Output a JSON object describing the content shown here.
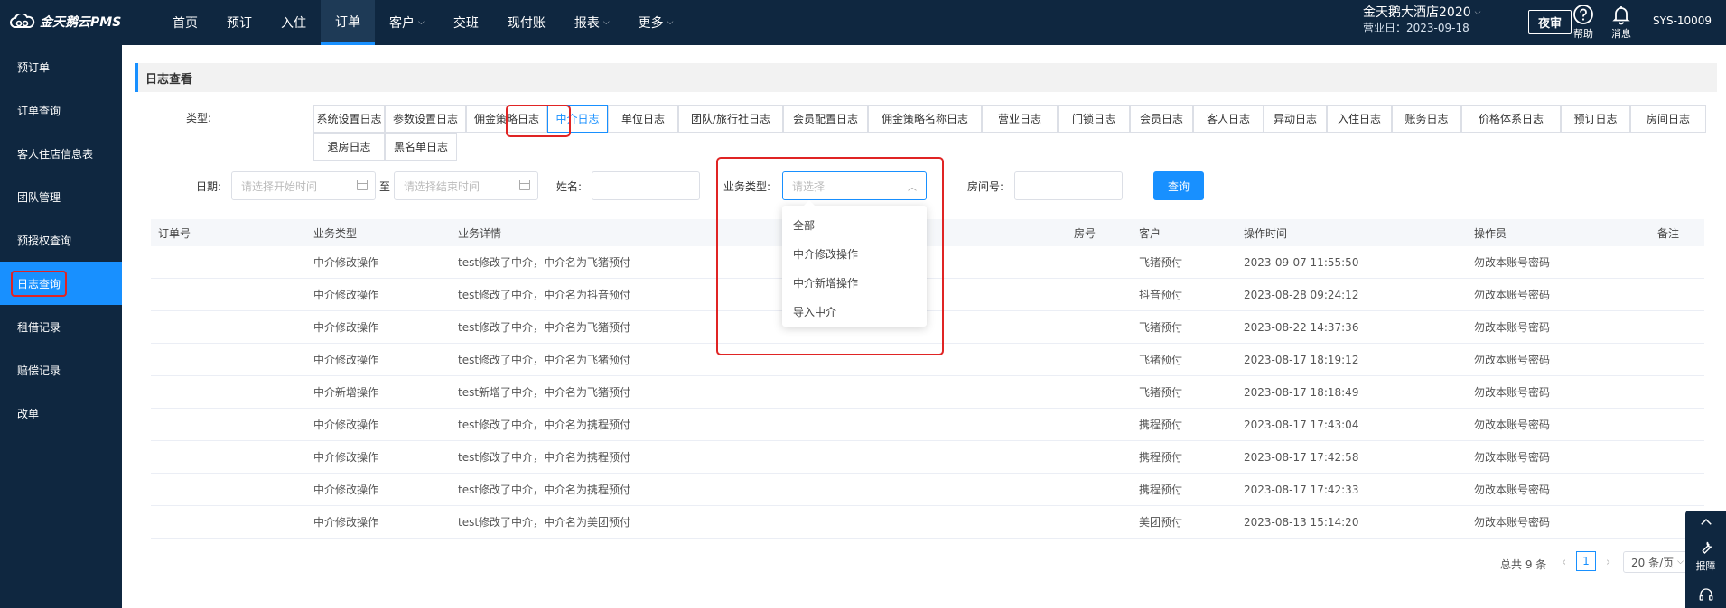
{
  "brand": {
    "logo_text": "金天鹅云PMS"
  },
  "nav": {
    "items": [
      {
        "label": "首页",
        "dropdown": false
      },
      {
        "label": "预订",
        "dropdown": false
      },
      {
        "label": "入住",
        "dropdown": false
      },
      {
        "label": "订单",
        "dropdown": false,
        "active": true
      },
      {
        "label": "客户",
        "dropdown": true
      },
      {
        "label": "交班",
        "dropdown": false
      },
      {
        "label": "现付账",
        "dropdown": false
      },
      {
        "label": "报表",
        "dropdown": true
      },
      {
        "label": "更多",
        "dropdown": true
      }
    ]
  },
  "hotel": {
    "name": "金天鹅大酒店2020",
    "business_day": "营业日：2023-09-18"
  },
  "header": {
    "night_audit": "夜审",
    "help": "帮助",
    "messages": "消息",
    "user": "SYS-10009"
  },
  "sidebar": {
    "items": [
      {
        "label": "预订单"
      },
      {
        "label": "订单查询"
      },
      {
        "label": "客人住店信息表"
      },
      {
        "label": "团队管理"
      },
      {
        "label": "预授权查询"
      },
      {
        "label": "日志查询",
        "active": true
      },
      {
        "label": "租借记录"
      },
      {
        "label": "赔偿记录"
      },
      {
        "label": "改单"
      }
    ]
  },
  "page": {
    "title": "日志查看"
  },
  "filters": {
    "type_label": "类型:",
    "date_label": "日期:",
    "date_start_placeholder": "请选择开始时间",
    "date_sep": "至",
    "date_end_placeholder": "请选择结束时间",
    "name_label": "姓名:",
    "biz_type_label": "业务类型:",
    "biz_type_placeholder": "请选择",
    "room_label": "房间号:",
    "query_button": "查询"
  },
  "log_tabs": [
    "系统设置日志",
    "参数设置日志",
    "佣金策略日志",
    "中介日志",
    "单位日志",
    "团队/旅行社日志",
    "会员配置日志",
    "佣金策略名称日志",
    "营业日志",
    "门锁日志",
    "会员日志",
    "客人日志",
    "异动日志",
    "入住日志",
    "账务日志",
    "价格体系日志",
    "预订日志",
    "房间日志",
    "退房日志",
    "黑名单日志"
  ],
  "active_tab": "中介日志",
  "biz_type_options": [
    "全部",
    "中介修改操作",
    "中介新增操作",
    "导入中介"
  ],
  "table": {
    "columns": [
      "订单号",
      "业务类型",
      "业务详情",
      "房号",
      "客户",
      "操作时间",
      "操作员",
      "备注"
    ],
    "rows": [
      {
        "order": "",
        "type": "中介修改操作",
        "detail": "test修改了中介，中介名为飞猪预付",
        "room": "",
        "customer": "飞猪预付",
        "time": "2023-09-07 11:55:50",
        "operator": "勿改本账号密码",
        "remark": ""
      },
      {
        "order": "",
        "type": "中介修改操作",
        "detail": "test修改了中介，中介名为抖音预付",
        "room": "",
        "customer": "抖音预付",
        "time": "2023-08-28 09:24:12",
        "operator": "勿改本账号密码",
        "remark": ""
      },
      {
        "order": "",
        "type": "中介修改操作",
        "detail": "test修改了中介，中介名为飞猪预付",
        "room": "",
        "customer": "飞猪预付",
        "time": "2023-08-22 14:37:36",
        "operator": "勿改本账号密码",
        "remark": ""
      },
      {
        "order": "",
        "type": "中介修改操作",
        "detail": "test修改了中介，中介名为飞猪预付",
        "room": "",
        "customer": "飞猪预付",
        "time": "2023-08-17 18:19:12",
        "operator": "勿改本账号密码",
        "remark": ""
      },
      {
        "order": "",
        "type": "中介新增操作",
        "detail": "test新增了中介，中介名为飞猪预付",
        "room": "",
        "customer": "飞猪预付",
        "time": "2023-08-17 18:18:49",
        "operator": "勿改本账号密码",
        "remark": ""
      },
      {
        "order": "",
        "type": "中介修改操作",
        "detail": "test修改了中介，中介名为携程预付",
        "room": "",
        "customer": "携程预付",
        "time": "2023-08-17 17:43:04",
        "operator": "勿改本账号密码",
        "remark": ""
      },
      {
        "order": "",
        "type": "中介修改操作",
        "detail": "test修改了中介，中介名为携程预付",
        "room": "",
        "customer": "携程预付",
        "time": "2023-08-17 17:42:58",
        "operator": "勿改本账号密码",
        "remark": ""
      },
      {
        "order": "",
        "type": "中介修改操作",
        "detail": "test修改了中介，中介名为携程预付",
        "room": "",
        "customer": "携程预付",
        "time": "2023-08-17 17:42:33",
        "operator": "勿改本账号密码",
        "remark": ""
      },
      {
        "order": "",
        "type": "中介修改操作",
        "detail": "test修改了中介，中介名为美团预付",
        "room": "",
        "customer": "美团预付",
        "time": "2023-08-13 15:14:20",
        "operator": "勿改本账号密码",
        "remark": ""
      }
    ]
  },
  "pagination": {
    "total": "总共 9 条",
    "current_page": "1",
    "page_size": "20 条/页"
  },
  "side_tools": {
    "report": "报障"
  },
  "colors": {
    "nav_bg": "#0f2740",
    "accent": "#1890ff",
    "highlight": "#e02424"
  }
}
